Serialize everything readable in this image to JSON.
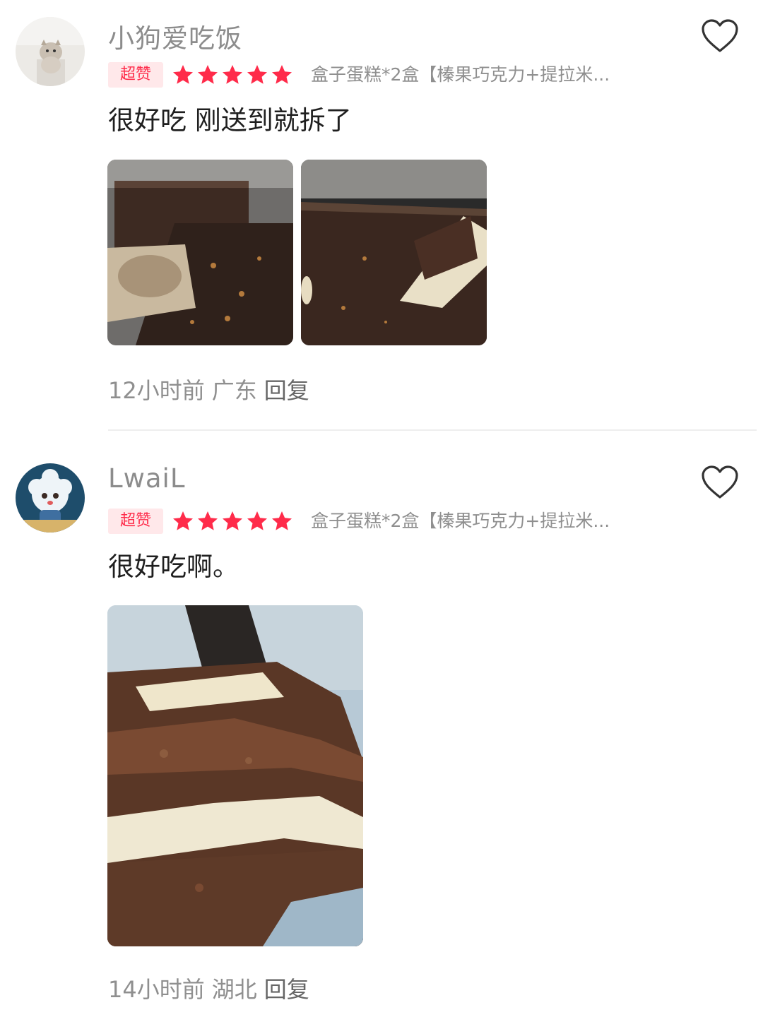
{
  "reviews": [
    {
      "username": "小狗爱吃饭",
      "badge": "超赞",
      "rating": 5,
      "product": "盒子蛋糕*2盒【榛果巧克力+提拉米...",
      "content": "很好吃 刚送到就拆了",
      "photos": [
        "hazelnut-chocolate-cake-photo",
        "tiramisu-cake-photo"
      ],
      "time": "12小时前",
      "location": "广东",
      "reply_label": "回复",
      "liked": false
    },
    {
      "username": "LwaiL",
      "badge": "超赞",
      "rating": 5,
      "product": "盒子蛋糕*2盒【榛果巧克力+提拉米...",
      "content": "很好吃啊。",
      "photos": [
        "tiramisu-slice-photo"
      ],
      "time": "14小时前",
      "location": "湖北",
      "reply_label": "回复",
      "liked": false
    }
  ],
  "colors": {
    "star": "#ff2b4a",
    "badge_bg": "#ffe8ea",
    "badge_text": "#ff2b4a",
    "meta_text": "#8f8f8f"
  },
  "icons": {
    "like": "heart-outline-icon",
    "star": "star-filled-icon"
  }
}
